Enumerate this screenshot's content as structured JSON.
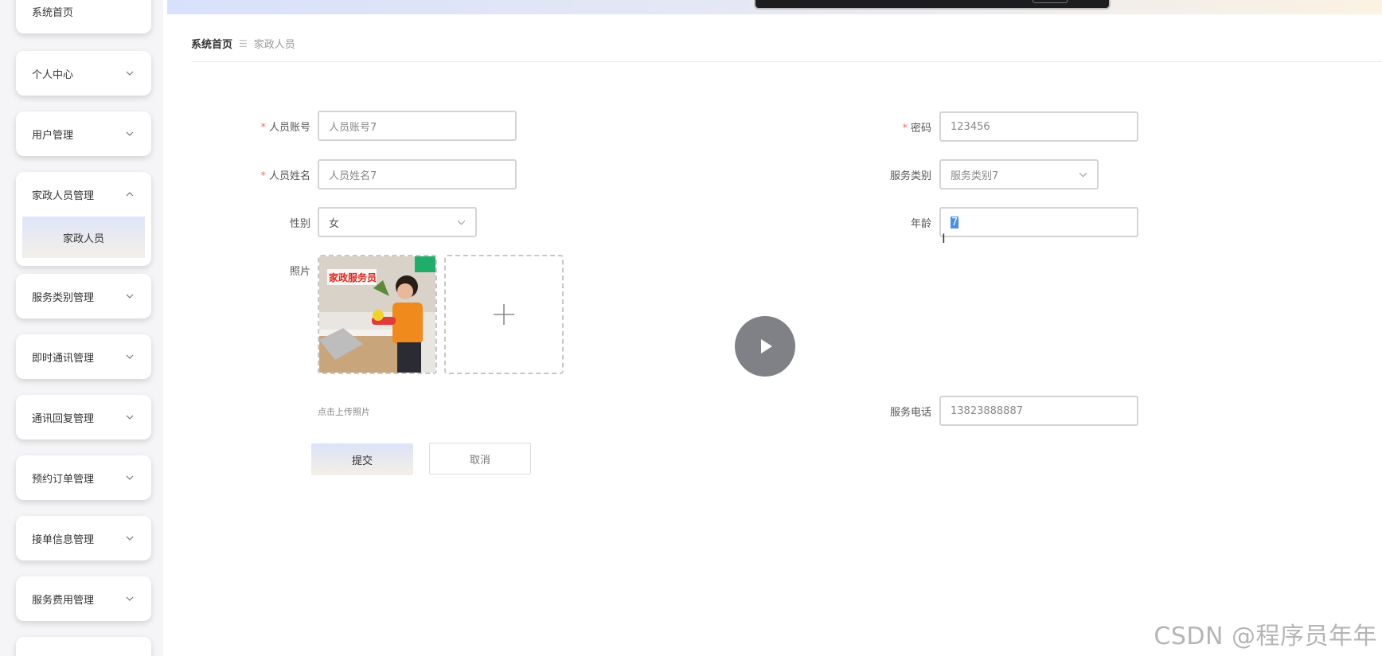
{
  "sidebar": {
    "home": "系统首页",
    "items": [
      {
        "label": "个人中心"
      },
      {
        "label": "用户管理"
      },
      {
        "label": "家政人员管理",
        "sub": "家政人员"
      },
      {
        "label": "服务类别管理"
      },
      {
        "label": "即时通讯管理"
      },
      {
        "label": "通讯回复管理"
      },
      {
        "label": "预约订单管理"
      },
      {
        "label": "接单信息管理"
      },
      {
        "label": "服务费用管理"
      }
    ]
  },
  "breadcrumb": {
    "home": "系统首页",
    "separator": "☰",
    "current": "家政人员"
  },
  "form": {
    "account": {
      "label": "人员账号",
      "value": "人员账号7"
    },
    "password": {
      "label": "密码",
      "value": "123456"
    },
    "name": {
      "label": "人员姓名",
      "value": "人员姓名7"
    },
    "service_type": {
      "label": "服务类别",
      "value": "服务类别7"
    },
    "gender": {
      "label": "性别",
      "value": "女"
    },
    "age": {
      "label": "年龄",
      "value": "7"
    },
    "photo": {
      "label": "照片",
      "image_caption": "家政服务员",
      "hint": "点击上传照片"
    },
    "phone": {
      "label": "服务电话",
      "value": "13823888887"
    },
    "required_mark": "*"
  },
  "actions": {
    "submit": "提交",
    "cancel": "取消"
  },
  "watermark": "CSDN @程序员年年"
}
